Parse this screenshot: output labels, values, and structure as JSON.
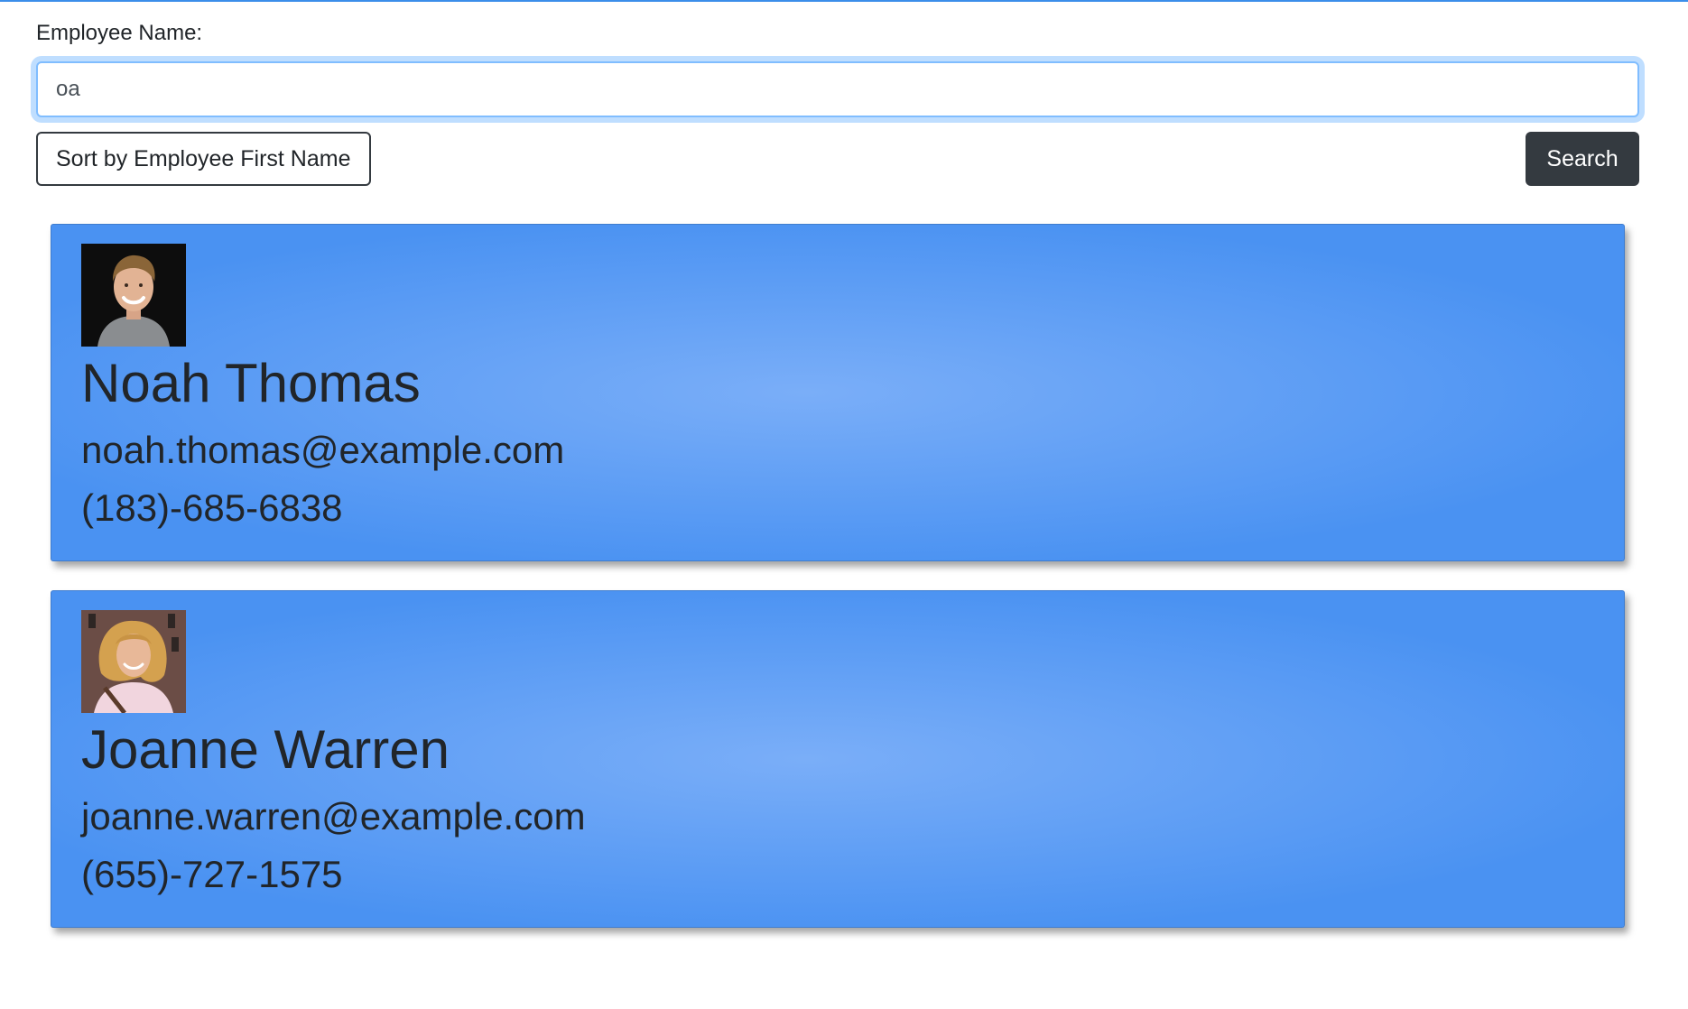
{
  "theme": {
    "accent": "#3b8eea",
    "card_gradient_center": "#7aaef8",
    "card_gradient_edge": "#4a92f2",
    "dark_button": "#343a40"
  },
  "search": {
    "label": "Employee Name:",
    "value": "oa",
    "sort_label": "Sort by Employee First Name",
    "search_label": "Search"
  },
  "employees": [
    {
      "name": "Noah Thomas",
      "email": "noah.thomas@example.com",
      "phone": "(183)-685-6838"
    },
    {
      "name": "Joanne Warren",
      "email": "joanne.warren@example.com",
      "phone": "(655)-727-1575"
    }
  ]
}
